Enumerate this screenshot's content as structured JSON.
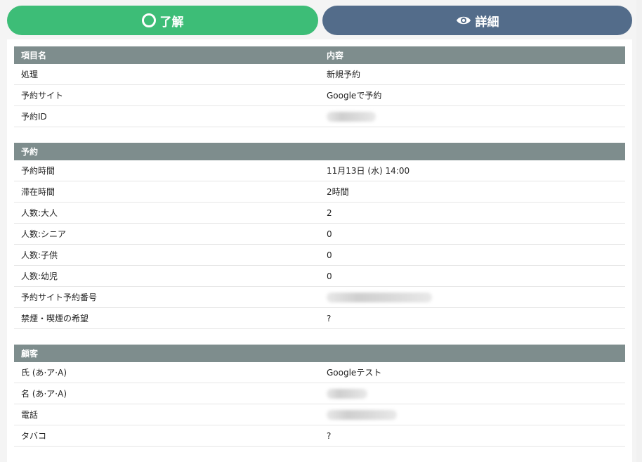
{
  "buttons": {
    "ok_label": "了解",
    "detail_label": "詳細"
  },
  "sections": {
    "top": {
      "header_col1": "項目名",
      "header_col2": "内容",
      "rows": [
        {
          "label": "処理",
          "value": "新規予約"
        },
        {
          "label": "予約サイト",
          "value": "Googleで予約"
        },
        {
          "label": "予約ID",
          "value": ""
        }
      ]
    },
    "reservation": {
      "header": "予約",
      "rows": [
        {
          "label": "予約時間",
          "value": "11月13日 (水) 14:00"
        },
        {
          "label": "滞在時間",
          "value": "2時間"
        },
        {
          "label": "人数:大人",
          "value": "2"
        },
        {
          "label": "人数:シニア",
          "value": "0"
        },
        {
          "label": "人数:子供",
          "value": "0"
        },
        {
          "label": "人数:幼児",
          "value": "0"
        },
        {
          "label": "予約サイト予約番号",
          "value": ""
        },
        {
          "label": "禁煙・喫煙の希望",
          "value": "?"
        }
      ]
    },
    "customer": {
      "header": "顧客",
      "rows": [
        {
          "label": "氏 (あ·ア·A)",
          "value": "Googleテスト"
        },
        {
          "label": "名 (あ·ア·A)",
          "value": ""
        },
        {
          "label": "電話",
          "value": ""
        },
        {
          "label": "タバコ",
          "value": "?"
        }
      ]
    }
  },
  "colors": {
    "ok_button": "#3dbd77",
    "detail_button": "#536c8a",
    "section_header": "#7e8d8d"
  }
}
